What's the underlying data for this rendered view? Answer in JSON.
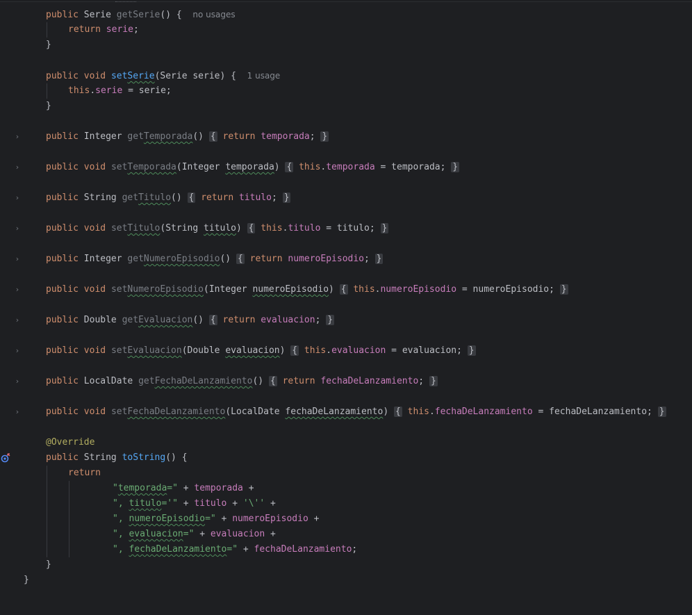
{
  "editor": {
    "language": "Java",
    "hints": {
      "no_usages": "no usages",
      "one_usage": "1 usage"
    },
    "icons": {
      "fold_marker": "chevron-right-icon",
      "override_marker": "override-method-icon"
    },
    "colors": {
      "background": "#1e1f22",
      "keyword": "#cf8e6d",
      "field": "#c77dbb",
      "method": "#56a8f5",
      "annotation": "#b3ae60",
      "string": "#6aab73",
      "text": "#bcbec4"
    }
  },
  "code": {
    "kw_public": "public",
    "kw_void": "void",
    "kw_return": "return",
    "kw_this": "this",
    "t_serie": "Serie",
    "t_integer": "Integer",
    "t_string": "String",
    "t_double": "Double",
    "t_localdate": "LocalDate",
    "m_getserie": "getSerie",
    "m_setserie_a": "set",
    "m_setserie_b": "Serie",
    "f_serie": "serie",
    "p_serie": "serie",
    "m_get": "get",
    "m_set": "set",
    "n_temporada": "Temporada",
    "n_titulo": "Titulo",
    "n_numeroepisodio": "NumeroEpisodio",
    "n_evaluacion": "Evaluacion",
    "n_fecha": "FechaDeLanzamiento",
    "f_temporada": "temporada",
    "f_titulo": "titulo",
    "f_numeroepisodio": "numeroEpisodio",
    "f_evaluacion": "evaluacion",
    "f_fecha": "fechaDeLanzamiento",
    "ann_override": "@Override",
    "m_tostring": "toString",
    "s_temporada_a": "\"",
    "s_temporada_b": "temporada",
    "s_temporada_c": "=\"",
    "s_titulo_a": "\", ",
    "s_titulo_b": "titulo",
    "s_titulo_c": "='\"",
    "s_quote": "'\\''",
    "s_num_a": "\", ",
    "s_num_b": "numeroEpisodio",
    "s_num_c": "=\"",
    "s_eval_a": "\", ",
    "s_eval_b": "evaluacion",
    "s_eval_c": "=\"",
    "s_fecha_a": "\", ",
    "s_fecha_b": "fechaDeLanzamiento",
    "s_fecha_c": "=\""
  }
}
